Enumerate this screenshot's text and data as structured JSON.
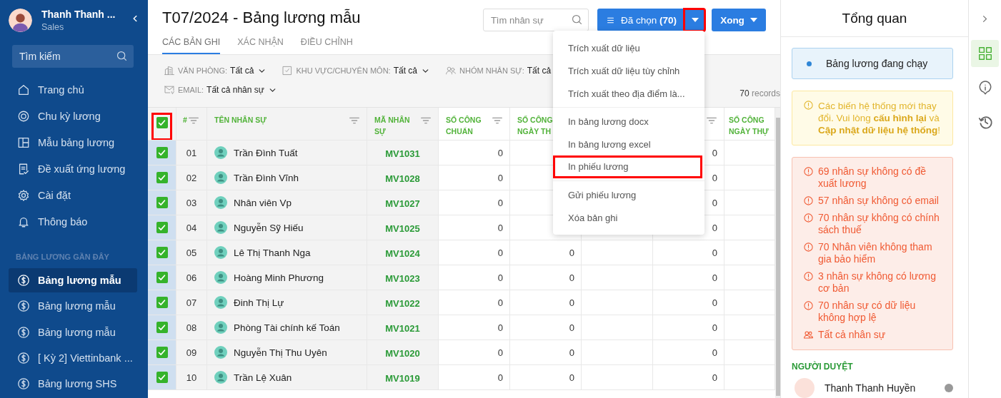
{
  "sidebar": {
    "user": {
      "name": "Thanh Thanh ...",
      "role": "Sales"
    },
    "search": {
      "placeholder": "Tìm kiếm"
    },
    "nav": [
      {
        "kind": "home",
        "label": "Trang chủ"
      },
      {
        "kind": "cycle",
        "label": "Chu kỳ lương"
      },
      {
        "kind": "template",
        "label": "Mẫu bảng lương"
      },
      {
        "kind": "request",
        "label": "Đề xuất ứng lương"
      },
      {
        "kind": "settings",
        "label": "Cài đặt"
      },
      {
        "kind": "notification",
        "label": "Thông báo"
      }
    ],
    "section_title": "BẢNG LƯƠNG GẦN ĐÂY",
    "recent": [
      {
        "label": "Bảng lương mẫu",
        "selected": true
      },
      {
        "label": "Bảng lương mẫu",
        "selected": false
      },
      {
        "label": "Bảng lương mẫu",
        "selected": false
      },
      {
        "label": "[ Kỳ 2] Viettinbank ...",
        "selected": false
      },
      {
        "label": "Bảng lương SHS",
        "selected": false
      }
    ]
  },
  "header": {
    "title": "T07/2024 - Bảng lương mẫu",
    "tabs": [
      {
        "label": "CÁC BẢN GHI",
        "selected": true
      },
      {
        "label": "XÁC NHẬN",
        "selected": false
      },
      {
        "label": "ĐIỀU CHỈNH",
        "selected": false
      }
    ],
    "search": {
      "placeholder": "Tìm nhân sự"
    },
    "selected_button": {
      "label": "Đã chọn",
      "count": "(70)",
      "caret_highlighted": true
    },
    "done_button": {
      "label": "Xong"
    }
  },
  "filters": [
    {
      "kind": "office",
      "label": "VĂN PHÒNG:",
      "value": "Tất cả"
    },
    {
      "kind": "area",
      "label": "KHU VỰC/CHUYÊN MÔN:",
      "value": "Tất cả"
    },
    {
      "kind": "group",
      "label": "NHÓM NHÂN SỰ:",
      "value": "Tất cả"
    },
    {
      "kind": "email",
      "label": "EMAIL:",
      "value": "Tất cả nhân sự"
    }
  ],
  "records": {
    "count": "70",
    "label": "records"
  },
  "table": {
    "select_all": {
      "checked": true,
      "highlighted": true
    },
    "columns": [
      {
        "label": "#",
        "filter": true
      },
      {
        "label": "TÊN NHÂN SỰ",
        "filter": true
      },
      {
        "label": "MÃ NHÂN SỰ",
        "filter": true
      },
      {
        "label": "SỐ CÔNG CHUẨN",
        "filter": true
      },
      {
        "label": "SỐ CÔNG NGÀY TH",
        "filter": false
      },
      {
        "filter": true
      },
      {
        "label": "SỐ CÔNG NGÀY THỰ",
        "filter": false
      }
    ],
    "rows": [
      {
        "checked": true,
        "index": "01",
        "name": "Trần Đình Tuất",
        "code": "MV1031",
        "so_cong_chuan": "0",
        "column_7": "0"
      },
      {
        "checked": true,
        "index": "02",
        "name": "Trần Đình Vĩnh",
        "code": "MV1028",
        "so_cong_chuan": "0",
        "column_7": "0"
      },
      {
        "checked": true,
        "index": "03",
        "name": "Nhân viên Vp",
        "code": "MV1027",
        "so_cong_chuan": "0",
        "column_7": "0"
      },
      {
        "checked": true,
        "index": "04",
        "name": "Nguyễn Sỹ Hiếu",
        "code": "MV1025",
        "so_cong_chuan": "0",
        "column_7": "0"
      },
      {
        "checked": true,
        "index": "05",
        "name": "Lê Thị Thanh Nga",
        "code": "MV1024",
        "so_cong_chuan": "0",
        "so_cong_ngay_th": "0",
        "column_7": "0"
      },
      {
        "checked": true,
        "index": "06",
        "name": "Hoàng Minh Phương",
        "code": "MV1023",
        "so_cong_chuan": "0",
        "so_cong_ngay_th": "0",
        "column_7": "0"
      },
      {
        "checked": true,
        "index": "07",
        "name": "Đinh Thị Lự",
        "code": "MV1022",
        "so_cong_chuan": "0",
        "so_cong_ngay_th": "0",
        "column_7": "0"
      },
      {
        "checked": true,
        "index": "08",
        "name": "Phòng Tài chính kế Toán",
        "code": "MV1021",
        "so_cong_chuan": "0",
        "so_cong_ngay_th": "0",
        "column_7": "0"
      },
      {
        "checked": true,
        "index": "09",
        "name": "Nguyễn Thị Thu Uyên",
        "code": "MV1020",
        "so_cong_chuan": "0",
        "so_cong_ngay_th": "0",
        "column_7": "0"
      },
      {
        "checked": true,
        "index": "10",
        "name": "Trần Lệ Xuân",
        "code": "MV1019",
        "so_cong_chuan": "0",
        "so_cong_ngay_th": "0",
        "column_7": "0"
      }
    ]
  },
  "menu": {
    "groups": [
      [
        {
          "label": "Trích xuất dữ liệu",
          "highlighted": false
        },
        {
          "label": "Trích xuất dữ liệu tùy chỉnh",
          "highlighted": false
        },
        {
          "label": "Trích xuất theo địa điểm là...",
          "highlighted": false
        }
      ],
      [
        {
          "label": "In bảng lương docx",
          "highlighted": false
        },
        {
          "label": "In bảng lương excel",
          "highlighted": false
        },
        {
          "label": "In phiếu lương",
          "highlighted": true
        }
      ],
      [
        {
          "label": "Gửi phiếu lương",
          "highlighted": false
        },
        {
          "label": "Xóa bản ghi",
          "highlighted": false
        }
      ]
    ]
  },
  "overview": {
    "title": "Tổng quan",
    "status": "Bảng lương đang chạy",
    "warning": "Các biến hệ thống mới thay đổi. Vui lòng **cấu hình lại** và **Cập nhật dữ liệu hệ thống**!",
    "issues": [
      {
        "kind": "alert",
        "text": "69 nhân sự không có đề xuất lương"
      },
      {
        "kind": "alert",
        "text": "57 nhân sự không có email"
      },
      {
        "kind": "alert",
        "text": "70 nhân sự không có chính sách thuế"
      },
      {
        "kind": "alert",
        "text": "70 Nhân viên không tham gia bảo hiểm"
      },
      {
        "kind": "alert",
        "text": "3 nhân sự không có lương cơ bản"
      },
      {
        "kind": "alert",
        "text": "70 nhân sự có dữ liệu không hợp lệ"
      },
      {
        "kind": "people",
        "text": "Tất cả nhân sự"
      }
    ],
    "approvers_title": "NGƯỜI DUYỆT",
    "approver": "Thanh Thanh Huyền"
  },
  "rail": [
    {
      "kind": "overview",
      "selected": true
    },
    {
      "kind": "info",
      "selected": false
    },
    {
      "kind": "history",
      "selected": false
    }
  ]
}
